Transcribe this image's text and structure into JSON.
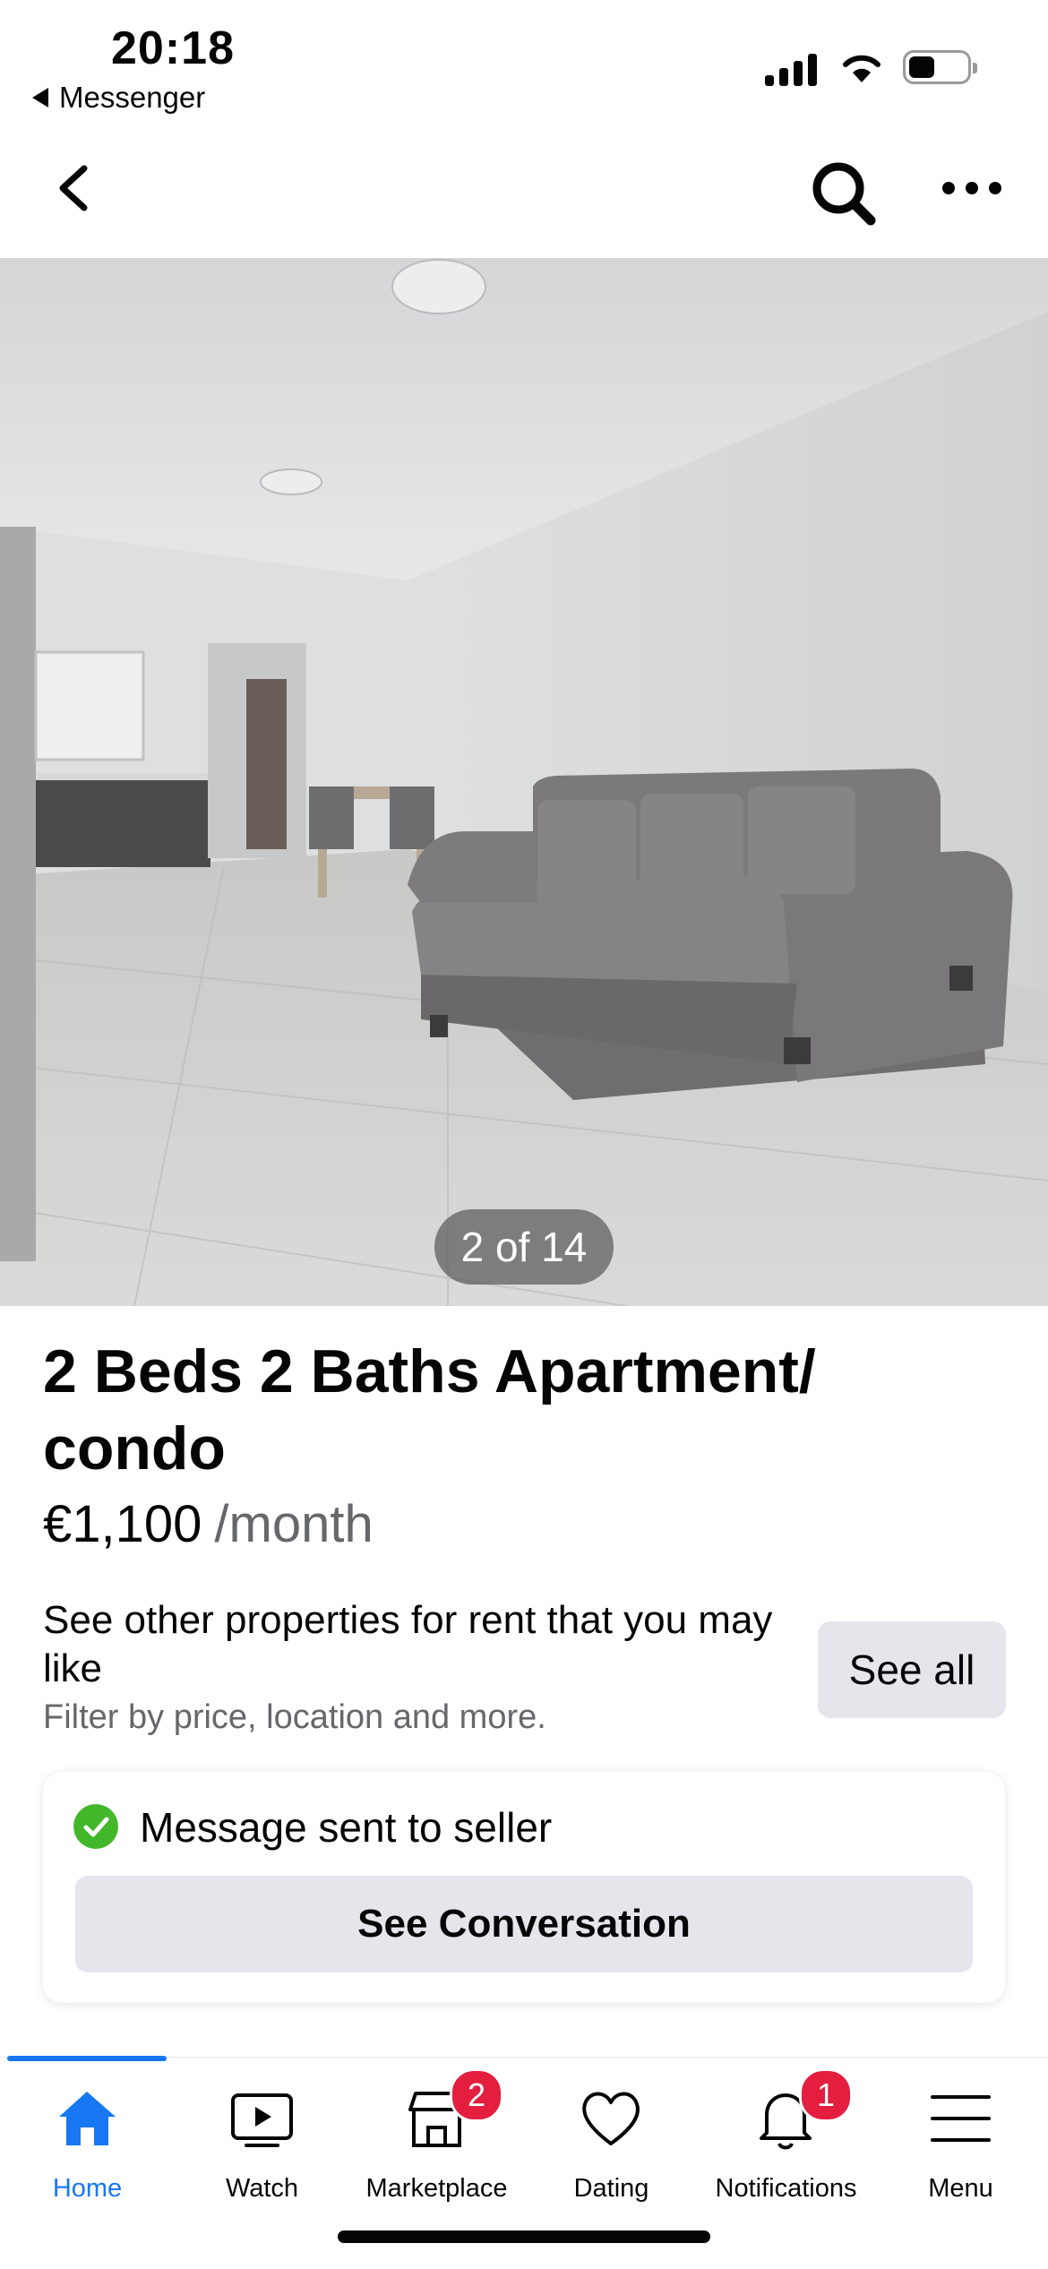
{
  "status_bar": {
    "time": "20:18",
    "back_app": "Messenger"
  },
  "photo": {
    "counter": "2 of 14"
  },
  "listing": {
    "title": "2 Beds 2 Baths Apartment/ condo",
    "price": "€1,100",
    "price_period": "/month"
  },
  "promo": {
    "title": "See other properties for rent that you may like",
    "subtitle": "Filter by price, location and more.",
    "button_label": "See all"
  },
  "message_card": {
    "status": "Message sent to seller",
    "button_label": "See Conversation"
  },
  "tab_bar": {
    "tabs": [
      {
        "label": "Home",
        "icon": "home-icon",
        "active": true
      },
      {
        "label": "Watch",
        "icon": "video-icon"
      },
      {
        "label": "Marketplace",
        "icon": "shop-icon",
        "badge": "2"
      },
      {
        "label": "Dating",
        "icon": "heart-icon"
      },
      {
        "label": "Notifications",
        "icon": "bell-icon",
        "badge": "1"
      },
      {
        "label": "Menu",
        "icon": "hamburger-icon"
      }
    ]
  },
  "colors": {
    "accent": "#1877f2",
    "badge": "#e41e3f",
    "success": "#42b72a",
    "secondary_text": "#65676b",
    "button_bg": "#e4e6eb"
  }
}
